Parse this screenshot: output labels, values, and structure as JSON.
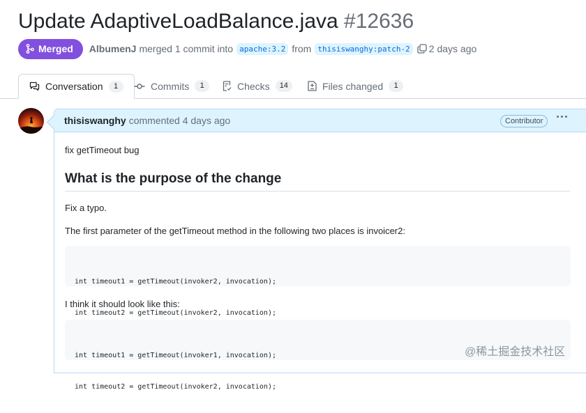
{
  "pr": {
    "title": "Update AdaptiveLoadBalance.java",
    "number": "#12636",
    "status": "Merged",
    "author": "AlbumenJ",
    "action": "merged 1 commit into",
    "base_branch": "apache:3.2",
    "from_word": "from",
    "head_branch": "thisiswanghy:patch-2",
    "time": "2 days ago"
  },
  "tabs": [
    {
      "label": "Conversation",
      "count": "1",
      "icon": "comment-icon"
    },
    {
      "label": "Commits",
      "count": "1",
      "icon": "commit-icon"
    },
    {
      "label": "Checks",
      "count": "14",
      "icon": "checklist-icon"
    },
    {
      "label": "Files changed",
      "count": "1",
      "icon": "file-diff-icon"
    }
  ],
  "comment": {
    "author": "thisiswanghy",
    "action": "commented 4 days ago",
    "role": "Contributor",
    "line1": "fix getTimeout bug",
    "heading": "What is the purpose of the change",
    "line2": "Fix a typo.",
    "line3": "The first parameter of the getTimeout method in the following two places is invoicer2:",
    "code1": [
      "int timeout1 = getTimeout(invoker2, invocation);",
      "int timeout2 = getTimeout(invoker2, invocation);"
    ],
    "line4": "I think it should look like this:",
    "code2": [
      "int timeout1 = getTimeout(invoker1, invocation);",
      "int timeout2 = getTimeout(invoker2, invocation);"
    ]
  },
  "watermark": "@稀土掘金技术社区",
  "colors": {
    "merged": "#8250df",
    "link": "#0969da",
    "header_bg": "#ddf4ff"
  }
}
